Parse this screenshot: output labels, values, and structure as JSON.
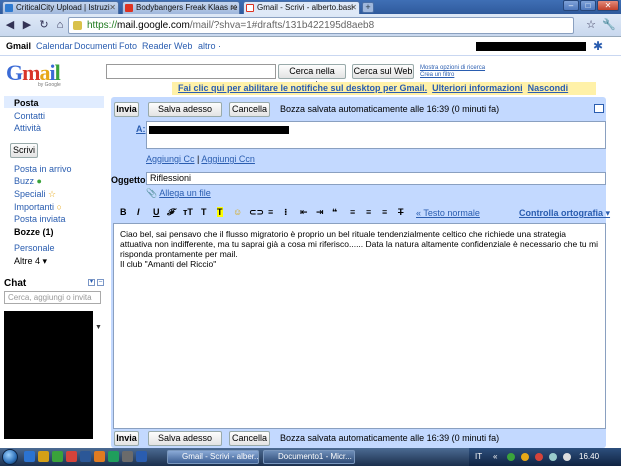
{
  "browser": {
    "tabs": [
      {
        "label": "CriticalCity Upload | Istruzi"
      },
      {
        "label": "Bodybangers Freak Klaas re"
      },
      {
        "label": "Gmail - Scrivi - alberto.basi"
      }
    ],
    "url_scheme": "https://",
    "url_host": "mail.google.com",
    "url_path": "/mail/?shva=1#drafts/131b422195d8aeb8"
  },
  "gbar": {
    "gmail": "Gmail",
    "calendar": "Calendar",
    "documenti": "Documenti",
    "foto": "Foto",
    "reader": "Reader",
    "web": "Web",
    "altro": "altro ·"
  },
  "header": {
    "logo_by": "by Google",
    "search_mail_button": "Cerca nella posta",
    "search_web_button": "Cerca sul Web",
    "advanced_search_link": "Mostra opzioni di ricerca",
    "create_filter_link": "Crea un filtro",
    "notification_text": "Fai clic qui per abilitare le notifiche sul desktop per Gmail.",
    "notification_more": "Ulteriori informazioni",
    "notification_hide": "Nascondi"
  },
  "sidebar": {
    "posta": "Posta",
    "contatti": "Contatti",
    "attivita": "Attività",
    "compose_button": "Scrivi",
    "folders": [
      "Posta in arrivo",
      "Buzz",
      "Speciali",
      "Importanti",
      "Posta inviata"
    ],
    "bozze": "Bozze (1)",
    "personale": "Personale",
    "altre": "Altre 4 ▾",
    "chat_title": "Chat",
    "chat_search_placeholder": "Cerca, aggiungi o invita"
  },
  "compose": {
    "send_button": "Invia",
    "save_button": "Salva adesso",
    "discard_button": "Cancella",
    "autosave_status": "Bozza salvata automaticamente alle 16:39 (0 minuti fa)",
    "to_label": "A:",
    "add_cc": "Aggiungi Cc",
    "separator": "|",
    "add_bcc": "Aggiungi Ccn",
    "subject_label": "Oggetto:",
    "subject_value": "Riflessioni",
    "attach_link": "Allega un file",
    "plain_text_link": "« Testo normale",
    "spellcheck_link": "Controlla ortografia ▾",
    "body_line1": "Ciao bel, sai pensavo che il flusso migratorio è proprio un bel rituale tendenzialmente celtico che richiede una strategia attuativa non indifferente, ma tu saprai già a cosa mi riferisco...... Data la natura altamente confidenziale è necessario che tu mi risponda prontamente per mail.",
    "body_line2": "Il club \"Amanti del Riccio\""
  },
  "taskbar": {
    "tasks": [
      "Gmail - Scrivi - alber...",
      "Documento1 - Micr..."
    ],
    "lang": "IT",
    "clock": "16.40"
  }
}
